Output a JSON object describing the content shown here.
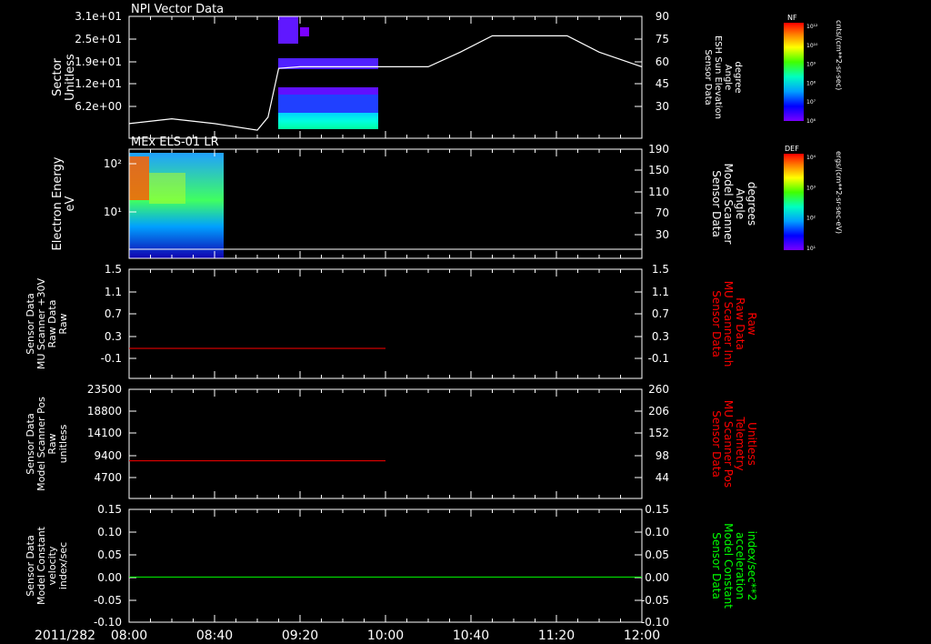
{
  "date_label": "2011/282",
  "time_ticks": [
    "08:00",
    "08:40",
    "09:20",
    "10:00",
    "10:40",
    "11:20",
    "12:00"
  ],
  "colors": {
    "background": "#000000",
    "axis": "#ffffff",
    "red": "#ff0000",
    "green": "#00ff00"
  },
  "colorbars": [
    {
      "label": "NF",
      "units": "cnts/(cm**2-sr-sec)",
      "ticks": [
        "10¹²",
        "10¹⁰",
        "10⁹",
        "10⁸",
        "10⁷",
        "10⁶"
      ]
    },
    {
      "label": "DEF",
      "units": "ergs/(cm**2-sr-sec-eV)",
      "ticks": [
        "10⁴",
        "10³",
        "10²",
        "10¹"
      ]
    }
  ],
  "chart_data": [
    {
      "type": "heatmap",
      "title": "NPI Vector Data",
      "ylabel_left": [
        "Sector",
        "Unitless"
      ],
      "ylabel_right": [
        "Sensor Data",
        "ESH Sun Elevation",
        "Angle",
        "degree"
      ],
      "left_ticks": [
        "3.1e+01",
        "2.5e+01",
        "1.9e+01",
        "1.2e+01",
        "6.2e+00"
      ],
      "right_ticks": [
        "90",
        "75",
        "60",
        "45",
        "30"
      ],
      "right_ylim": [
        15,
        90
      ],
      "overlay_line": {
        "x": [
          "08:00",
          "08:20",
          "08:40",
          "09:00",
          "09:05",
          "09:10",
          "09:20",
          "09:40",
          "10:00",
          "10:20",
          "10:35",
          "10:50",
          "11:10",
          "11:25",
          "11:40",
          "12:00"
        ],
        "y": [
          24,
          27,
          24,
          20,
          28,
          58,
          59,
          59,
          59,
          59,
          68,
          78,
          78,
          78,
          68,
          59
        ]
      }
    },
    {
      "type": "heatmap",
      "title": "MEx ELS-01 LR",
      "ylabel_left": [
        "Electron Energy",
        "eV"
      ],
      "ylabel_right": [
        "Sensor Data",
        "Model Scanner",
        "Angle",
        "degrees"
      ],
      "left_ticks": [
        "10²",
        "10¹"
      ],
      "right_ticks": [
        "190",
        "150",
        "110",
        "70",
        "30"
      ],
      "right_ylim": [
        0,
        190
      ]
    },
    {
      "type": "line",
      "ylabel_left": [
        "Sensor Data",
        "MU Scanner +30V",
        "Raw Data",
        "Raw"
      ],
      "ylabel_right": [
        "Sensor Data",
        "MU Scanner Inh",
        "Raw Data",
        "Raw"
      ],
      "left_ticks": [
        "1.5",
        "1.1",
        "0.7",
        "0.3",
        "-0.1"
      ],
      "right_ticks": [
        "1.5",
        "1.1",
        "0.7",
        "0.3",
        "-0.1"
      ],
      "ylim": [
        -0.5,
        1.5
      ],
      "series": [
        {
          "color": "#ff0000",
          "x": [
            "08:00",
            "10:00"
          ],
          "y": [
            0.05,
            0.05
          ]
        }
      ]
    },
    {
      "type": "line",
      "ylabel_left": [
        "Sensor Data",
        "Model Scanner Pos",
        "Raw",
        "unitless"
      ],
      "ylabel_right": [
        "Sensor Data",
        "MU Scanner Pos",
        "Telemetry",
        "Unitless"
      ],
      "left_ticks": [
        "23500",
        "18800",
        "14100",
        "9400",
        "4700"
      ],
      "right_ticks": [
        "260",
        "206",
        "152",
        "98",
        "44"
      ],
      "ylim": [
        0,
        23500
      ],
      "series": [
        {
          "color": "#ff0000",
          "x": [
            "08:00",
            "10:00"
          ],
          "y": [
            8100,
            8100
          ]
        }
      ]
    },
    {
      "type": "line",
      "ylabel_left": [
        "Sensor Data",
        "Model Constant",
        "velocity",
        "index/sec"
      ],
      "ylabel_right": [
        "Sensor Data",
        "Model Constant",
        "acceleration",
        "index/sec**2"
      ],
      "left_ticks": [
        "0.15",
        "0.10",
        "0.05",
        "0.00",
        "-0.05",
        "-0.10"
      ],
      "right_ticks": [
        "0.15",
        "0.10",
        "0.05",
        "0.00",
        "-0.05",
        "-0.10"
      ],
      "ylim": [
        -0.1,
        0.15
      ],
      "series": [
        {
          "color": "#00ff00",
          "x": [
            "08:00",
            "12:00"
          ],
          "y": [
            0.0,
            0.0
          ]
        }
      ]
    }
  ]
}
